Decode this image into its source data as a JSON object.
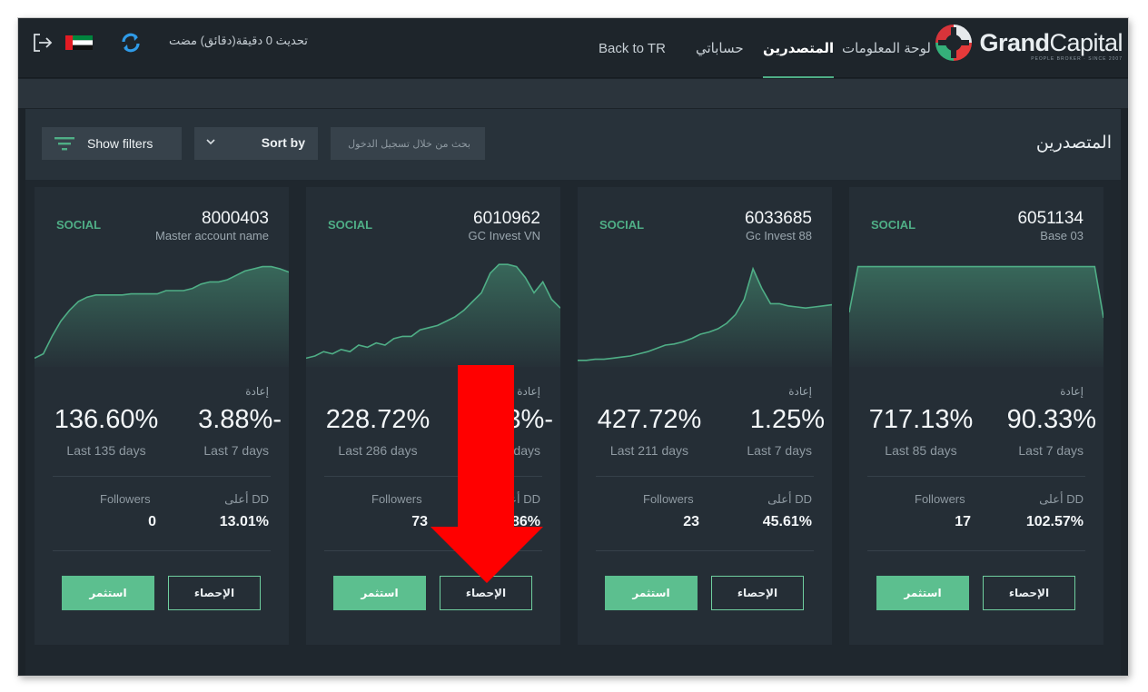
{
  "header": {
    "brand_bold": "Grand",
    "brand_light": "Capital",
    "brand_sub": "PEOPLE BROKER · SINCE 2007",
    "nav": [
      "لوحة المعلومات",
      "المتصدرين",
      "حساباتي",
      "Back to TR"
    ],
    "update_text": "تحديث 0 دقيقة(دقائق) مضت"
  },
  "toolbar": {
    "filters_label": "Show filters",
    "sort_label": "Sort by",
    "search_placeholder": "بحث من خلال تسجيل الدخول",
    "page_title": "المتصدرين"
  },
  "colors": {
    "accent": "#4fae86",
    "button": "#5cbf8f",
    "card": "#252e36"
  },
  "cards": [
    {
      "social": "SOCIAL",
      "account": "8000403",
      "name": "Master account name",
      "return_label": "إعادة",
      "total_return": "136.60%",
      "total_period": "Last 135 days",
      "week_return": "3.88%-",
      "week_period": "Last 7 days",
      "followers_label": "Followers",
      "followers": "0",
      "dd_label": "أعلى DD",
      "dd": "13.01%",
      "invest_label": "استثمر",
      "stats_label": "الإحصاء",
      "series": [
        0.08,
        0.12,
        0.28,
        0.42,
        0.52,
        0.6,
        0.64,
        0.66,
        0.66,
        0.66,
        0.66,
        0.67,
        0.67,
        0.67,
        0.67,
        0.7,
        0.7,
        0.7,
        0.72,
        0.76,
        0.78,
        0.78,
        0.8,
        0.84,
        0.88,
        0.9,
        0.92,
        0.92,
        0.9,
        0.87
      ]
    },
    {
      "social": "SOCIAL",
      "account": "6010962",
      "name": "GC Invest VN",
      "return_label": "إعادة",
      "total_return": "228.72%",
      "total_period": "Last 286 days",
      "week_return": "1.53%-",
      "week_period": "Last 7 days",
      "followers_label": "Followers",
      "followers": "73",
      "dd_label": "أعلى DD",
      "dd": "15.86%",
      "invest_label": "استثمر",
      "stats_label": "الإحصاء",
      "series": [
        0.08,
        0.1,
        0.14,
        0.12,
        0.16,
        0.14,
        0.2,
        0.18,
        0.22,
        0.2,
        0.26,
        0.28,
        0.28,
        0.34,
        0.36,
        0.38,
        0.42,
        0.46,
        0.52,
        0.6,
        0.68,
        0.86,
        0.94,
        0.94,
        0.92,
        0.82,
        0.68,
        0.78,
        0.62,
        0.54
      ]
    },
    {
      "social": "SOCIAL",
      "account": "6033685",
      "name": "Gc Invest 88",
      "return_label": "إعادة",
      "total_return": "427.72%",
      "total_period": "Last 211 days",
      "week_return": "1.25%",
      "week_period": "Last 7 days",
      "followers_label": "Followers",
      "followers": "23",
      "dd_label": "أعلى DD",
      "dd": "45.61%",
      "invest_label": "استثمر",
      "stats_label": "الإحصاء",
      "series": [
        0.06,
        0.06,
        0.07,
        0.07,
        0.08,
        0.09,
        0.1,
        0.12,
        0.14,
        0.17,
        0.2,
        0.21,
        0.23,
        0.26,
        0.3,
        0.32,
        0.35,
        0.4,
        0.48,
        0.62,
        0.9,
        0.72,
        0.58,
        0.58,
        0.56,
        0.55,
        0.54,
        0.55,
        0.56,
        0.57
      ]
    },
    {
      "social": "SOCIAL",
      "account": "6051134",
      "name": "Base 03",
      "return_label": "إعادة",
      "total_return": "717.13%",
      "total_period": "Last 85 days",
      "week_return": "90.33%",
      "week_period": "Last 7 days",
      "followers_label": "Followers",
      "followers": "17",
      "dd_label": "أعلى DD",
      "dd": "102.57%",
      "invest_label": "استثمر",
      "stats_label": "الإحصاء",
      "series": [
        0.5,
        0.92,
        0.92,
        0.92,
        0.92,
        0.92,
        0.92,
        0.92,
        0.92,
        0.92,
        0.92,
        0.92,
        0.92,
        0.92,
        0.92,
        0.92,
        0.92,
        0.92,
        0.92,
        0.92,
        0.92,
        0.92,
        0.92,
        0.92,
        0.92,
        0.92,
        0.92,
        0.92,
        0.92,
        0.45
      ]
    }
  ]
}
